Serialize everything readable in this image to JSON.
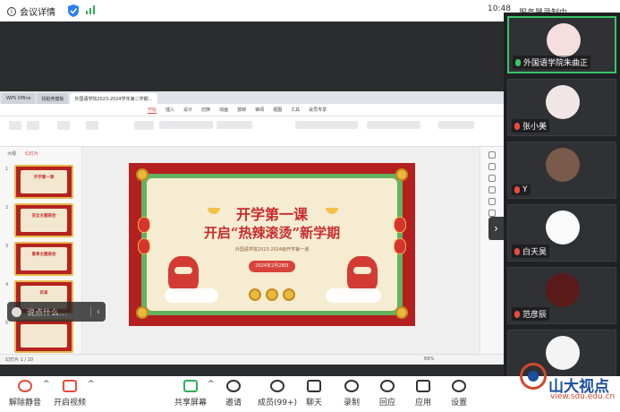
{
  "topbar": {
    "meeting_info": "会议详情",
    "time": "10:48",
    "record_status": "服务器录制中"
  },
  "share": {
    "tabs": [
      "WPS Office",
      "找稻壳模板",
      "外国语学院2023-2024学年第二学期…"
    ],
    "menus": [
      "开始",
      "插入",
      "设计",
      "切换",
      "动画",
      "放映",
      "审阅",
      "视图",
      "工具",
      "会员专享"
    ],
    "thumb_tabs": [
      "大纲",
      "幻灯片"
    ],
    "thumbs": [
      {
        "num": "1",
        "text": "开学第一课"
      },
      {
        "num": "2",
        "text": "安全主题班会"
      },
      {
        "num": "3",
        "text": "春季主题班会"
      },
      {
        "num": "4",
        "text": "目录"
      },
      {
        "num": "5",
        "text": ""
      }
    ],
    "status_left": "幻灯片 1 / 10",
    "status_zoom": "69%"
  },
  "slide": {
    "title": "开学第一课",
    "subtitle": "开启“热辣滚烫”新学期",
    "small": "外国语学院2023-2024级开学第一课",
    "date": "2024年2月28日"
  },
  "chat": {
    "placeholder": "说点什么…"
  },
  "participants": [
    {
      "name": "外国语学院朱曲正",
      "mic": "on"
    },
    {
      "name": "张小美",
      "mic": "off"
    },
    {
      "name": "Y",
      "mic": "off"
    },
    {
      "name": "白天昊",
      "mic": "off"
    },
    {
      "name": "范彦辰",
      "mic": "off"
    },
    {
      "name": "",
      "mic": "off"
    }
  ],
  "toolbar": {
    "unmute": "解除静音",
    "video": "开启视频",
    "share": "共享屏幕",
    "invite": "邀请",
    "members": "成员(99+)",
    "chat": "聊天",
    "record": "录制",
    "replay": "回应",
    "apps": "应用",
    "settings": "设置"
  },
  "watermark": {
    "title": "山大视点",
    "subtitle": "view.sdu.edu.cn"
  }
}
